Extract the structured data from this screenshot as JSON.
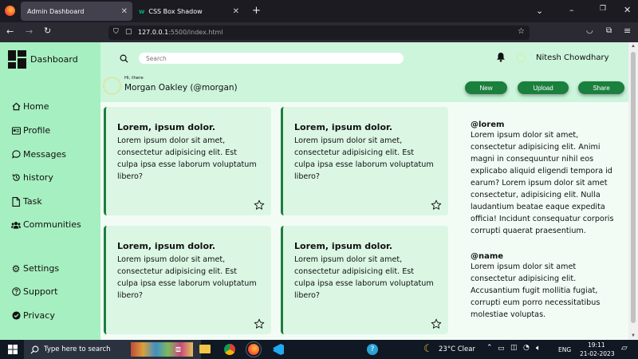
{
  "browser": {
    "tabs": [
      {
        "title": "Admin Dashboard",
        "active": true
      },
      {
        "title": "CSS Box Shadow",
        "active": false
      }
    ],
    "url_host": "127.0.0.1",
    "url_rest": ":5500/index.html"
  },
  "app": {
    "brand": "Dashboard",
    "search_placeholder": "Search",
    "user_name": "Nitesh Chowdhary",
    "greeting": "Hi, there",
    "profile_name": "Morgan Oakley (@morgan)",
    "actions": {
      "new": "New",
      "upload": "Upload",
      "share": "Share"
    },
    "accent": "#1b7f3d"
  },
  "sidebar": {
    "items": [
      {
        "label": "Home",
        "icon": "home-icon"
      },
      {
        "label": "Profile",
        "icon": "profile-card-icon"
      },
      {
        "label": "Messages",
        "icon": "chat-icon"
      },
      {
        "label": "history",
        "icon": "history-icon"
      },
      {
        "label": "Task",
        "icon": "task-icon"
      },
      {
        "label": "Communities",
        "icon": "users-icon"
      }
    ],
    "bottom_items": [
      {
        "label": "Settings",
        "icon": "gear-icon"
      },
      {
        "label": "Support",
        "icon": "question-icon"
      },
      {
        "label": "Privacy",
        "icon": "check-circle-icon"
      }
    ]
  },
  "cards": [
    {
      "title": "Lorem, ipsum dolor.",
      "body": "Lorem ipsum dolor sit amet, consectetur adipisicing elit. Est culpa ipsa esse laborum voluptatum libero?"
    },
    {
      "title": "Lorem, ipsum dolor.",
      "body": "Lorem ipsum dolor sit amet, consectetur adipisicing elit. Est culpa ipsa esse laborum voluptatum libero?"
    },
    {
      "title": "Lorem, ipsum dolor.",
      "body": "Lorem ipsum dolor sit amet, consectetur adipisicing elit. Est culpa ipsa esse laborum voluptatum libero?"
    },
    {
      "title": "Lorem, ipsum dolor.",
      "body": "Lorem ipsum dolor sit amet, consectetur adipisicing elit. Est culpa ipsa esse laborum voluptatum libero?"
    }
  ],
  "aside": {
    "sections": [
      {
        "handle": "@lorem",
        "text": "Lorem ipsum dolor sit amet, consectetur adipisicing elit. Animi magni in consequuntur nihil eos explicabo aliquid eligendi tempora id earum? Lorem ipsum dolor sit amet consectetur, adipisicing elit. Nulla laudantium beatae eaque expedita officia! Incidunt consequatur corporis corrupti quaerat praesentium."
      },
      {
        "handle": "@name",
        "text": "Lorem ipsum dolor sit amet consectetur adipisicing elit. Accusantium fugit mollitia fugiat, corrupti eum porro necessitatibus molestiae voluptas."
      }
    ]
  },
  "taskbar": {
    "search_placeholder": "Type here to search",
    "weather": "23°C  Clear",
    "lang": "ENG",
    "time": "19:11",
    "date": "21-02-2023"
  }
}
